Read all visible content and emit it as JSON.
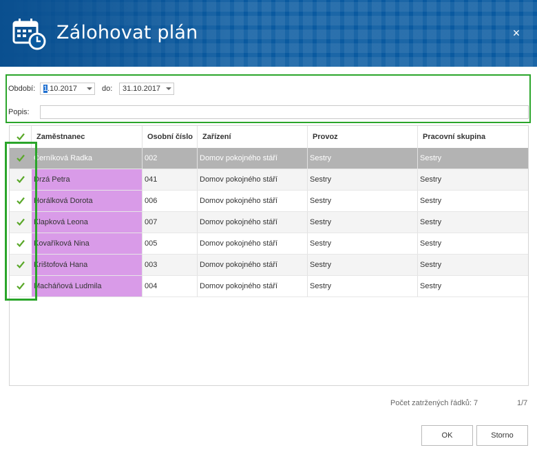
{
  "dialog": {
    "title": "Zálohovat plán",
    "close_label": "×",
    "icon": "calendar-clock-icon"
  },
  "filters": {
    "period_label": "Období:",
    "period_from_cursor": "1",
    "period_from_rest": ".10.2017",
    "to_label": "do:",
    "period_to": "31.10.2017",
    "description_label": "Popis:",
    "description_value": ""
  },
  "grid": {
    "columns": [
      "Zaměstnanec",
      "Osobní číslo",
      "Zařízení",
      "Provoz",
      "Pracovní skupina"
    ],
    "check_color": "#5aa829",
    "name_highlight_color": "#d99be8",
    "rows": [
      {
        "checked": true,
        "name": "Černíková Radka",
        "number": "002",
        "facility": "Domov pokojného stáří",
        "operation": "Sestry",
        "group": "Sestry"
      },
      {
        "checked": true,
        "name": "Drzá Petra",
        "number": "041",
        "facility": "Domov pokojného stáří",
        "operation": "Sestry",
        "group": "Sestry"
      },
      {
        "checked": true,
        "name": "Horálková Dorota",
        "number": "006",
        "facility": "Domov pokojného stáří",
        "operation": "Sestry",
        "group": "Sestry"
      },
      {
        "checked": true,
        "name": "Klapková Leona",
        "number": "007",
        "facility": "Domov pokojného stáří",
        "operation": "Sestry",
        "group": "Sestry"
      },
      {
        "checked": true,
        "name": "Kovaříková Nina",
        "number": "005",
        "facility": "Domov pokojného stáří",
        "operation": "Sestry",
        "group": "Sestry"
      },
      {
        "checked": true,
        "name": "Krištofová Hana",
        "number": "003",
        "facility": "Domov pokojného stáří",
        "operation": "Sestry",
        "group": "Sestry"
      },
      {
        "checked": true,
        "name": "Macháňová Ludmila",
        "number": "004",
        "facility": "Domov pokojného stáří",
        "operation": "Sestry",
        "group": "Sestry"
      }
    ]
  },
  "footer": {
    "count_label": "Počet zatržených řádků: 7",
    "page": "1/7"
  },
  "buttons": {
    "ok": "OK",
    "cancel": "Storno"
  }
}
